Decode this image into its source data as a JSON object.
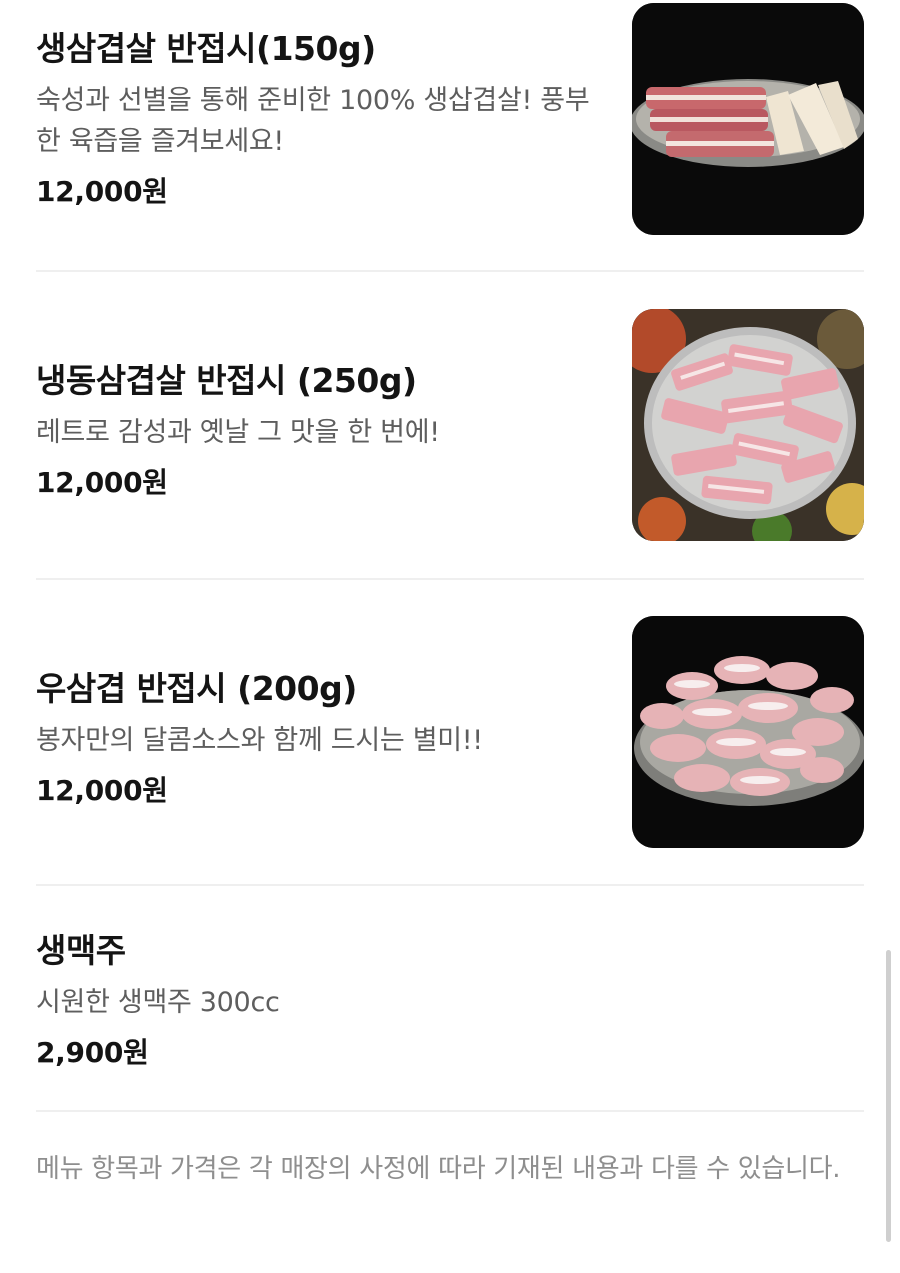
{
  "menu": {
    "items": [
      {
        "name": "생삼겹살 반접시(150g)",
        "description": "숙성과 선별을 통해 준비한 100% 생삽겹살! 풍부한 육즙을 즐겨보세요!",
        "price": "12,000원"
      },
      {
        "name": "냉동삼겹살 반접시 (250g)",
        "description": "레트로 감성과 옛날 그 맛을 한 번에!",
        "price": "12,000원"
      },
      {
        "name": "우삼겹 반접시 (200g)",
        "description": "봉자만의 달콤소스와 함께 드시는 별미!!",
        "price": "12,000원"
      },
      {
        "name": "생맥주",
        "description": "시원한 생맥주 300cc",
        "price": "2,900원"
      }
    ],
    "notice": "메뉴 항목과 가격은 각 매장의 사정에 따라 기재된 내용과 다를 수 있습니다."
  },
  "colors": {
    "title": "#141414",
    "description": "#5e5e5e",
    "notice": "#8e8e8e",
    "divider": "#efefef",
    "thumb_background": "#0b0b0b"
  }
}
